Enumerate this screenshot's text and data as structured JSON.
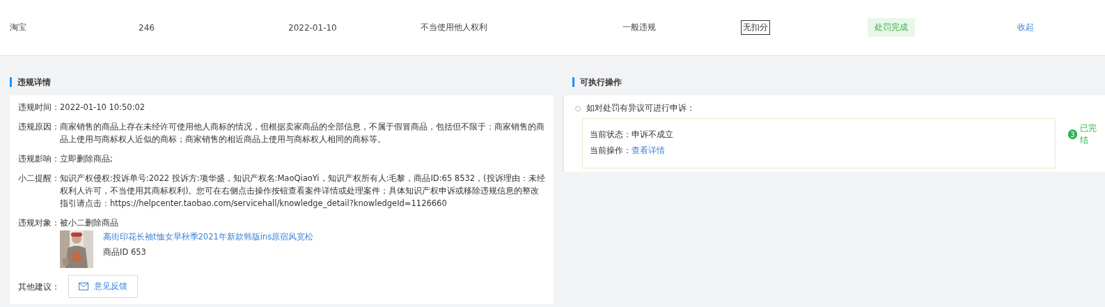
{
  "summary_row": {
    "cells": [
      "淘宝",
      "246",
      "2022-01-10",
      "不当使用他人权利",
      "一般违规"
    ],
    "deduction": "无扣分",
    "status": "处罚完成",
    "collapse_link": "收起"
  },
  "details": {
    "title": "违规详情",
    "rows": [
      {
        "label": "违规时间：",
        "value": "2022-01-10 10:50:02"
      },
      {
        "label": "违规原因：",
        "value": "商家销售的商品上存在未经许可使用他人商标的情况，但根据卖家商品的全部信息，不属于假冒商品，包括但不限于：商家销售的商品上使用与商标权人近似的商标；商家销售的相近商品上使用与商标权人相同的商标等。"
      },
      {
        "label": "违规影响：",
        "value": "立即删除商品;"
      },
      {
        "label": "小二提醒：",
        "value": "知识产权侵权:投诉单号:2022 投诉方:项华盛，知识产权名:MaoQiaoYi，知识产权所有人:毛黎，商品ID:65 8532，(投诉理由：未经权利人许可，不当使用其商标权利)。您可在右侧点击操作按钮查看案件详情或处理案件；具体知识产权申诉或移除违规信息的整改指引请点击：https://helpcenter.taobao.com/servicehall/knowledge_detail?knowledgeId=1126660"
      }
    ],
    "object_label": "违规对象：",
    "object_value": "被小二删除商品",
    "product": {
      "kind": "picture",
      "title": "高街印花长袖t恤女早秋季2021年新款韩版ins原宿风宽松",
      "id": "商品ID 653"
    },
    "advice_label": "其他建议：",
    "feedback_button": "意见反馈"
  },
  "actions": {
    "title": "可执行操作",
    "prompt": "如对处罚有异议可进行申诉：",
    "state_label": "当前状态：",
    "state_value": "申诉不成立",
    "op_label": "当前操作：",
    "op_link": "查看详情",
    "step_number": "3",
    "step_label": "已完结"
  }
}
